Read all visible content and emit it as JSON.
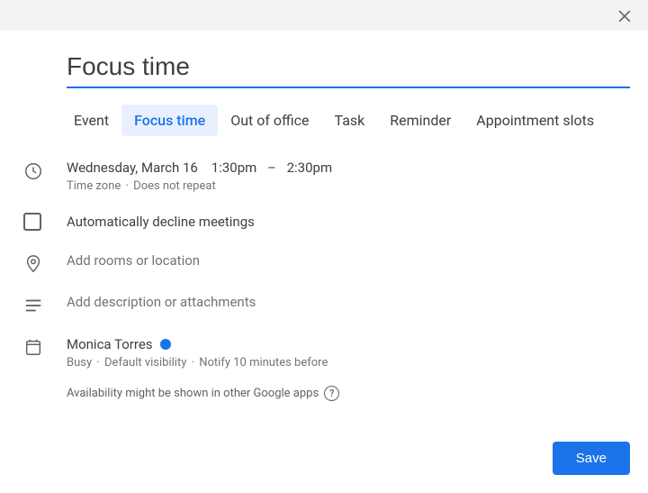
{
  "colors": {
    "accent": "#1a73e8"
  },
  "title": "Focus time",
  "tabs": [
    {
      "label": "Event",
      "active": false
    },
    {
      "label": "Focus time",
      "active": true
    },
    {
      "label": "Out of office",
      "active": false
    },
    {
      "label": "Task",
      "active": false
    },
    {
      "label": "Reminder",
      "active": false
    },
    {
      "label": "Appointment slots",
      "active": false
    }
  ],
  "datetime": {
    "date": "Wednesday, March 16",
    "start": "1:30pm",
    "dash": "–",
    "end": "2:30pm",
    "timezone_label": "Time zone",
    "repeat_label": "Does not repeat"
  },
  "auto_decline_label": "Automatically decline meetings",
  "location_placeholder": "Add rooms or location",
  "description_placeholder": "Add description or attachments",
  "organizer": {
    "name": "Monica Torres",
    "busy": "Busy",
    "visibility": "Default visibility",
    "notify": "Notify 10 minutes before"
  },
  "availability_note": "Availability might be shown in other Google apps",
  "save_label": "Save"
}
